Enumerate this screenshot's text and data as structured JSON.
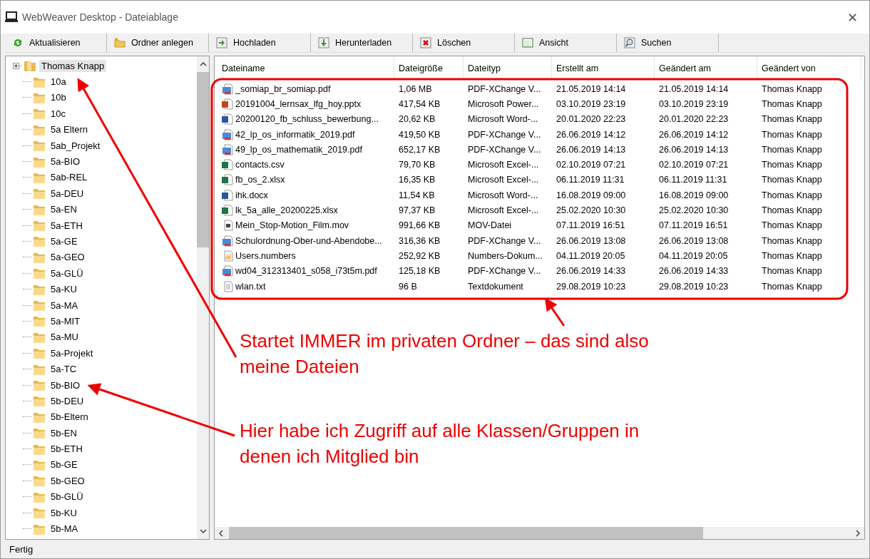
{
  "window": {
    "title": "WebWeaver Desktop - Dateiablage",
    "close": "✕"
  },
  "toolbar": [
    {
      "label": "Aktualisieren",
      "kind": "refresh"
    },
    {
      "label": "Ordner anlegen",
      "kind": "newfolder"
    },
    {
      "label": "Hochladen",
      "kind": "upload"
    },
    {
      "label": "Herunterladen",
      "kind": "download"
    },
    {
      "label": "Löschen",
      "kind": "delete"
    },
    {
      "label": "Ansicht",
      "kind": "view"
    },
    {
      "label": "Suchen",
      "kind": "search"
    }
  ],
  "tree": {
    "root": {
      "label": "Thomas Knapp",
      "selected": true,
      "children": [
        {
          "label": "10a"
        },
        {
          "label": "10b"
        },
        {
          "label": "10c"
        },
        {
          "label": "5a Eltern"
        },
        {
          "label": "5ab_Projekt"
        },
        {
          "label": "5a-BIO"
        },
        {
          "label": "5ab-REL"
        },
        {
          "label": "5a-DEU"
        },
        {
          "label": "5a-EN"
        },
        {
          "label": "5a-ETH"
        },
        {
          "label": "5a-GE"
        },
        {
          "label": "5a-GEO"
        },
        {
          "label": "5a-GLÜ"
        },
        {
          "label": "5a-KU"
        },
        {
          "label": "5a-MA"
        },
        {
          "label": "5a-MIT"
        },
        {
          "label": "5a-MU"
        },
        {
          "label": "5a-Projekt"
        },
        {
          "label": "5a-TC"
        },
        {
          "label": "5b-BIO"
        },
        {
          "label": "5b-DEU"
        },
        {
          "label": "5b-Eltern"
        },
        {
          "label": "5b-EN"
        },
        {
          "label": "5b-ETH"
        },
        {
          "label": "5b-GE"
        },
        {
          "label": "5b-GEO"
        },
        {
          "label": "5b-GLÜ"
        },
        {
          "label": "5b-KU"
        },
        {
          "label": "5b-MA"
        }
      ]
    }
  },
  "table": {
    "columns": [
      "Dateiname",
      "Dateigröße",
      "Dateityp",
      "Erstellt am",
      "Geändert am",
      "Geändert von"
    ],
    "rows": [
      {
        "kind": "pdf",
        "cells": [
          "_somiap_br_somiap.pdf",
          "1,06 MB",
          "PDF-XChange V...",
          "21.05.2019 14:14",
          "21.05.2019 14:14",
          "Thomas Knapp"
        ]
      },
      {
        "kind": "pptx",
        "cells": [
          "20191004_lernsax_lfg_hoy.pptx",
          "417,54 KB",
          "Microsoft Power...",
          "03.10.2019 23:19",
          "03.10.2019 23:19",
          "Thomas Knapp"
        ]
      },
      {
        "kind": "docx",
        "cells": [
          "20200120_fb_schluss_bewerbung...",
          "20,62 KB",
          "Microsoft Word-...",
          "20.01.2020 22:23",
          "20.01.2020 22:23",
          "Thomas Knapp"
        ]
      },
      {
        "kind": "pdf",
        "cells": [
          "42_lp_os_informatik_2019.pdf",
          "419,50 KB",
          "PDF-XChange V...",
          "26.06.2019 14:12",
          "26.06.2019 14:12",
          "Thomas Knapp"
        ]
      },
      {
        "kind": "pdf",
        "cells": [
          "49_lp_os_mathematik_2019.pdf",
          "652,17 KB",
          "PDF-XChange V...",
          "26.06.2019 14:13",
          "26.06.2019 14:13",
          "Thomas Knapp"
        ]
      },
      {
        "kind": "csv",
        "cells": [
          "contacts.csv",
          "79,70 KB",
          "Microsoft Excel-...",
          "02.10.2019 07:21",
          "02.10.2019 07:21",
          "Thomas Knapp"
        ]
      },
      {
        "kind": "xlsx",
        "cells": [
          "fb_os_2.xlsx",
          "16,35 KB",
          "Microsoft Excel-...",
          "06.11.2019 11:31",
          "06.11.2019 11:31",
          "Thomas Knapp"
        ]
      },
      {
        "kind": "docx",
        "cells": [
          "ihk.docx",
          "11,54 KB",
          "Microsoft Word-...",
          "16.08.2019 09:00",
          "16.08.2019 09:00",
          "Thomas Knapp"
        ]
      },
      {
        "kind": "xlsx",
        "cells": [
          "lk_5a_alle_20200225.xlsx",
          "97,37 KB",
          "Microsoft Excel-...",
          "25.02.2020 10:30",
          "25.02.2020 10:30",
          "Thomas Knapp"
        ]
      },
      {
        "kind": "mov",
        "cells": [
          "Mein_Stop-Motion_Film.mov",
          "991,66 KB",
          "MOV-Datei",
          "07.11.2019 16:51",
          "07.11.2019 16:51",
          "Thomas Knapp"
        ]
      },
      {
        "kind": "pdf",
        "cells": [
          "Schulordnung-Ober-und-Abendobe...",
          "316,36 KB",
          "PDF-XChange V...",
          "26.06.2019 13:08",
          "26.06.2019 13:08",
          "Thomas Knapp"
        ]
      },
      {
        "kind": "numbers",
        "cells": [
          "Users.numbers",
          "252,92 KB",
          "Numbers-Dokum...",
          "04.11.2019 20:05",
          "04.11.2019 20:05",
          "Thomas Knapp"
        ]
      },
      {
        "kind": "pdf",
        "cells": [
          "wd04_312313401_s058_i73t5m.pdf",
          "125,18 KB",
          "PDF-XChange V...",
          "26.06.2019 14:33",
          "26.06.2019 14:33",
          "Thomas Knapp"
        ]
      },
      {
        "kind": "txt",
        "cells": [
          "wlan.txt",
          "96 B",
          "Textdokument",
          "29.08.2019 10:23",
          "29.08.2019 10:23",
          "Thomas Knapp"
        ]
      }
    ]
  },
  "status_bar": "Fertig",
  "annotations": [
    {
      "text": "Startet IMMER im privaten Ordner – das sind also\nmeine Dateien"
    },
    {
      "text": "Hier habe ich Zugriff auf alle Klassen/Gruppen in\ndenen ich Mitglied bin"
    }
  ]
}
